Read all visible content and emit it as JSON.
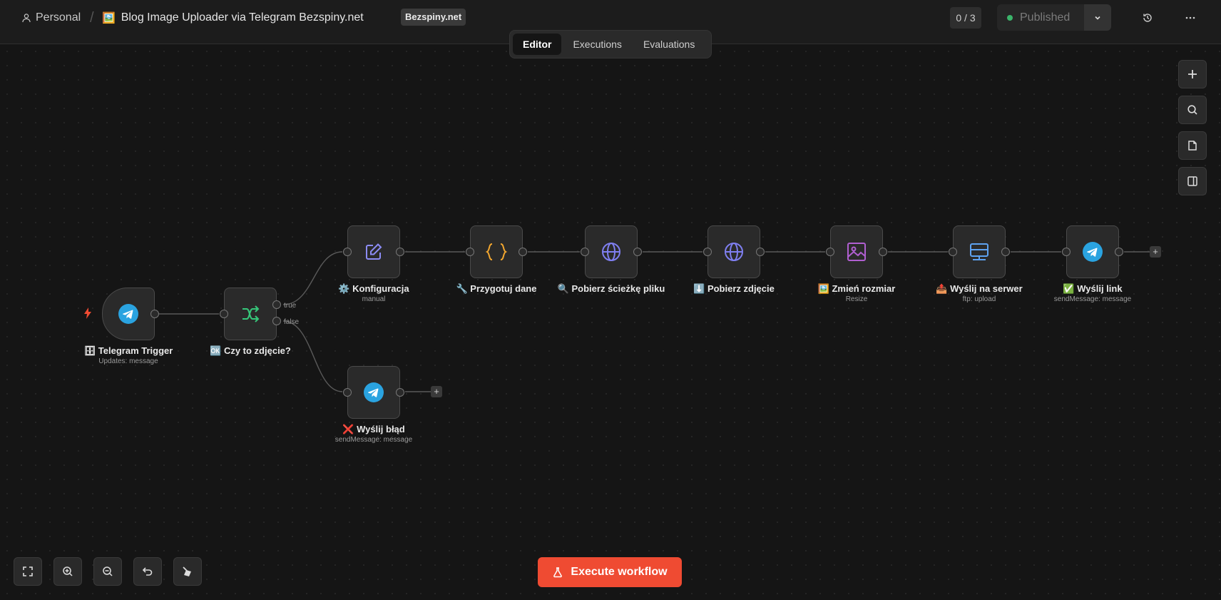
{
  "header": {
    "personal_label": "Personal",
    "separator": "/",
    "title_emoji": "🖼️",
    "title": "Blog Image Uploader via Telegram Bezspiny.net",
    "tag": "Bezspiny.net",
    "counter": "0 / 3",
    "publish_label": "Published",
    "publish_status_color": "#3bb46a"
  },
  "tabs": [
    {
      "label": "Editor",
      "active": true
    },
    {
      "label": "Executions",
      "active": false
    },
    {
      "label": "Evaluations",
      "active": false
    }
  ],
  "nodes": {
    "telegram_trigger": {
      "label": "🗄 Telegram Trigger",
      "sub": "Updates: message",
      "icon": "telegram-icon"
    },
    "czy_to_zdjecie": {
      "label": "🆗 Czy to zdjęcie?",
      "sub": "",
      "icon": "if-branch-icon",
      "true_label": "true",
      "false_label": "false"
    },
    "konfiguracja": {
      "label": "⚙️ Konfiguracja",
      "sub": "manual",
      "icon": "edit-icon"
    },
    "przygotuj_dane": {
      "label": "🔧 Przygotuj dane",
      "sub": "",
      "icon": "code-braces-icon"
    },
    "pobierz_sciezke": {
      "label": "🔍 Pobierz ścieżkę pliku",
      "sub": "",
      "icon": "globe-icon"
    },
    "pobierz_zdjecie": {
      "label": "⬇️ Pobierz zdjęcie",
      "sub": "",
      "icon": "globe-icon"
    },
    "zmien_rozmiar": {
      "label": "🖼️ Zmień rozmiar",
      "sub": "Resize",
      "icon": "image-icon"
    },
    "wyslij_na_serwer": {
      "label": "📤 Wyślij na serwer",
      "sub": "ftp: upload",
      "icon": "server-icon"
    },
    "wyslij_link": {
      "label": "✅ Wyślij link",
      "sub": "sendMessage: message",
      "icon": "telegram-icon"
    },
    "wyslij_blad": {
      "label": "❌ Wyślij błąd",
      "sub": "sendMessage: message",
      "icon": "telegram-icon"
    }
  },
  "plus_label": "+",
  "execute_button": "Execute workflow",
  "colors": {
    "accent": "#ef4b32",
    "telegram": "#2aa3e0",
    "branch": "#36c77a",
    "code": "#f3a72f",
    "http": "#7f7ff0",
    "image": "#b05fd0",
    "server": "#5ea2f0"
  }
}
